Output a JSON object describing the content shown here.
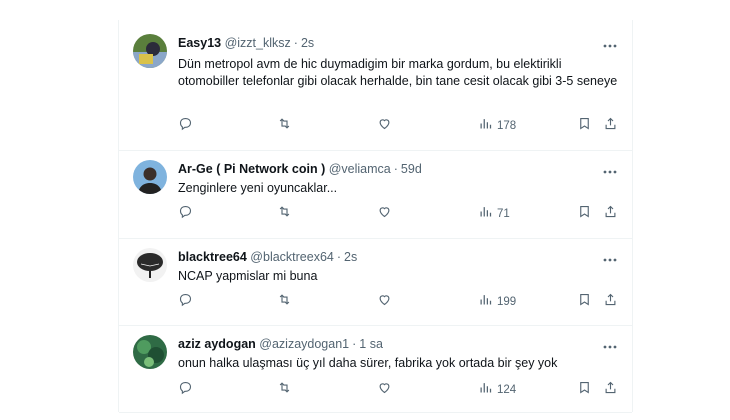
{
  "tweets": [
    {
      "name": "Easy13",
      "handle": "@izzt_klksz",
      "dot": "·",
      "time": "2s",
      "text": "Dün metropol avm de hic duymadigim bir marka gordum, bu elektirikli otomobiller telefonlar gibi olacak herhalde, bin tane cesit olacak gibi 3-5 seneye",
      "views": "178",
      "avatar_color": "#4b7a3a"
    },
    {
      "name": "Ar-Ge ( Pi Network coin )",
      "handle": "@veliamca",
      "dot": "·",
      "time": "59d",
      "text": "Zenginlere yeni oyuncaklar...",
      "views": "71",
      "avatar_color": "#6fa8d8"
    },
    {
      "name": "blacktree64",
      "handle": "@blacktreex64",
      "dot": "·",
      "time": "2s",
      "text": "NCAP yapmislar mi buna",
      "views": "199",
      "avatar_color": "#3a3a3a"
    },
    {
      "name": "aziz aydogan",
      "handle": "@azizaydogan1",
      "dot": "·",
      "time": "1 sa",
      "text": "onun halka ulaşması üç yıl daha sürer, fabrika yok ortada bir şey yok",
      "views": "124",
      "avatar_color": "#2f7a52"
    }
  ],
  "icons": {
    "reply": "reply-icon",
    "retweet": "retweet-icon",
    "like": "heart-icon",
    "views": "views-icon",
    "bookmark": "bookmark-icon",
    "share": "share-icon",
    "more": "more-icon"
  }
}
